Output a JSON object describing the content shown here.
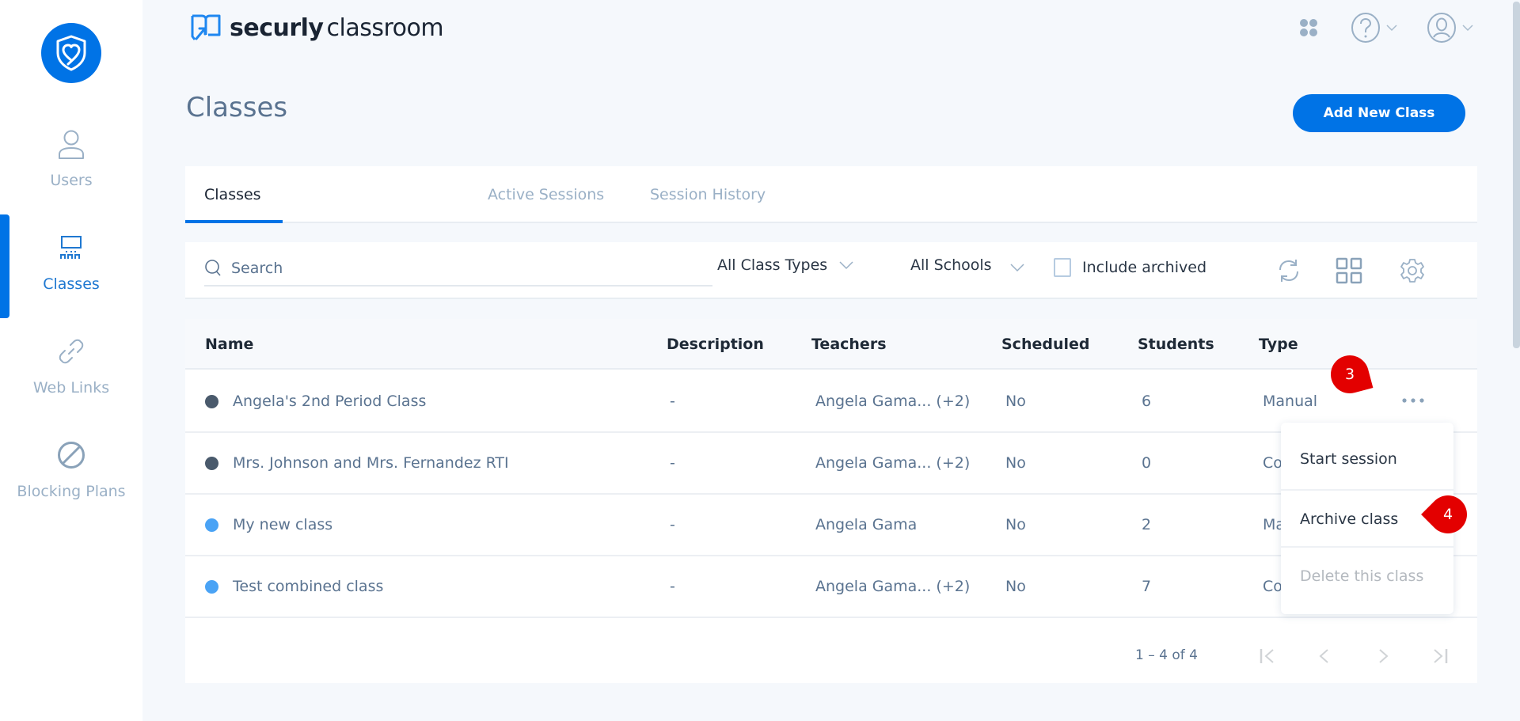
{
  "sidebar": {
    "logo": "securly-shield-heart-logo",
    "items": [
      {
        "label": "Users",
        "icon": "user-icon",
        "active": false
      },
      {
        "label": "Classes",
        "icon": "classroom-icon",
        "active": true
      },
      {
        "label": "Web Links",
        "icon": "link-icon",
        "active": false
      },
      {
        "label": "Blocking Plans",
        "icon": "block-icon",
        "active": false
      }
    ]
  },
  "header": {
    "brand_bold": "securly",
    "brand_light": "classroom",
    "icons": [
      "apps-icon",
      "help-icon",
      "account-icon"
    ]
  },
  "page": {
    "title": "Classes",
    "add_button": "Add New Class"
  },
  "tabs": [
    {
      "label": "Classes",
      "active": true
    },
    {
      "label": "Active Sessions",
      "active": false
    },
    {
      "label": "Session History",
      "active": false
    }
  ],
  "toolbar": {
    "search_placeholder": "Search",
    "search_value": "",
    "class_type_filter": "All Class Types",
    "school_filter": "All Schools",
    "include_archived_label": "Include archived",
    "include_archived_checked": false
  },
  "table": {
    "columns": [
      "Name",
      "Description",
      "Teachers",
      "Scheduled",
      "Students",
      "Type"
    ],
    "rows": [
      {
        "status_color": "#4a5a6c",
        "name": "Angela's 2nd Period Class",
        "description": "-",
        "teachers": "Angela Gama... (+2)",
        "scheduled": "No",
        "students": "6",
        "type": "Manual"
      },
      {
        "status_color": "#4a5a6c",
        "name": "Mrs. Johnson and Mrs. Fernandez RTI",
        "description": "-",
        "teachers": "Angela Gama... (+2)",
        "scheduled": "No",
        "students": "0",
        "type": "Co"
      },
      {
        "status_color": "#4aa3f5",
        "name": "My new class",
        "description": "-",
        "teachers": "Angela Gama",
        "scheduled": "No",
        "students": "2",
        "type": "Ma"
      },
      {
        "status_color": "#4aa3f5",
        "name": "Test combined class",
        "description": "-",
        "teachers": "Angela Gama... (+2)",
        "scheduled": "No",
        "students": "7",
        "type": "Co"
      }
    ],
    "pagination": {
      "range_text": "1 – 4 of 4",
      "buttons": [
        "first-page",
        "previous-page",
        "next-page",
        "last-page"
      ]
    }
  },
  "row_menu": {
    "items": [
      {
        "label": "Start session",
        "disabled": false
      },
      {
        "label": "Archive class",
        "disabled": false
      },
      {
        "label": "Delete this class",
        "disabled": true
      }
    ]
  },
  "annotations": [
    {
      "label": "3",
      "target": "row-actions-menu-button"
    },
    {
      "label": "4",
      "target": "archive-class-menu-item"
    }
  ],
  "colors": {
    "accent": "#0073e6",
    "badge": "#e30000",
    "background": "#f5f8fc"
  }
}
